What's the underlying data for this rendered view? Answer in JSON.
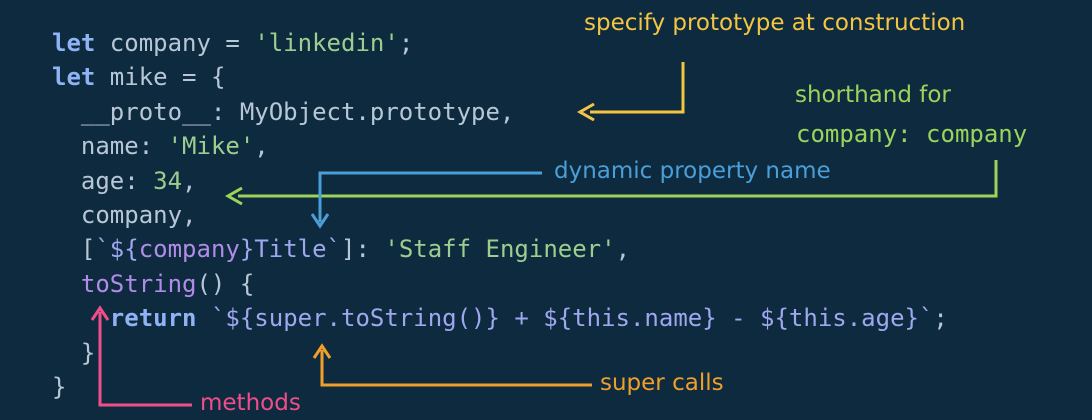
{
  "code": {
    "lines": [
      {
        "indent": 0,
        "tokens": [
          {
            "t": "let",
            "c": "kw"
          },
          {
            "t": " company = ",
            "c": "plain"
          },
          {
            "t": "'linkedin'",
            "c": "str"
          },
          {
            "t": ";",
            "c": "plain"
          }
        ]
      },
      {
        "indent": 0,
        "tokens": [
          {
            "t": "let",
            "c": "kw"
          },
          {
            "t": " mike = {",
            "c": "plain"
          }
        ]
      },
      {
        "indent": 2,
        "tokens": [
          {
            "t": "__proto__: MyObject.prototype,",
            "c": "plain"
          }
        ]
      },
      {
        "indent": 2,
        "tokens": [
          {
            "t": "name: ",
            "c": "plain"
          },
          {
            "t": "'Mike'",
            "c": "str"
          },
          {
            "t": ",",
            "c": "plain"
          }
        ]
      },
      {
        "indent": 2,
        "tokens": [
          {
            "t": "age: ",
            "c": "plain"
          },
          {
            "t": "34",
            "c": "num"
          },
          {
            "t": ",",
            "c": "plain"
          }
        ]
      },
      {
        "indent": 2,
        "tokens": [
          {
            "t": "company,",
            "c": "plain"
          }
        ]
      },
      {
        "indent": 2,
        "tokens": [
          {
            "t": "[",
            "c": "plain"
          },
          {
            "t": "`${",
            "c": "tmpl"
          },
          {
            "t": "company",
            "c": "fn"
          },
          {
            "t": "}",
            "c": "tmpl"
          },
          {
            "t": "Title`",
            "c": "tmpl"
          },
          {
            "t": "]: ",
            "c": "plain"
          },
          {
            "t": "'Staff Engineer'",
            "c": "str"
          },
          {
            "t": ",",
            "c": "plain"
          }
        ]
      },
      {
        "indent": 2,
        "tokens": [
          {
            "t": "toString",
            "c": "fn"
          },
          {
            "t": "() {",
            "c": "plain"
          }
        ]
      },
      {
        "indent": 4,
        "tokens": [
          {
            "t": "return",
            "c": "kw"
          },
          {
            "t": " ",
            "c": "plain"
          },
          {
            "t": "`${super.toString()} + ${this.name} - ${this.age}`",
            "c": "tmpl"
          },
          {
            "t": ";",
            "c": "plain"
          }
        ]
      },
      {
        "indent": 2,
        "tokens": [
          {
            "t": "}",
            "c": "plain"
          }
        ]
      },
      {
        "indent": 0,
        "tokens": [
          {
            "t": "}",
            "c": "plain"
          }
        ]
      }
    ]
  },
  "annotations": {
    "proto": "specify prototype at construction",
    "shorthand_1": "shorthand for",
    "shorthand_2": "company: company",
    "dynamic": "dynamic property name",
    "super": "super calls",
    "methods": "methods"
  },
  "colors": {
    "background": "#0e2a3f",
    "kw": "#8fb3f5",
    "plain": "#b8c7d6",
    "str": "#9ccf8f",
    "num": "#9ccf8f",
    "tmpl": "#9fa7ef",
    "fn": "#b08ce8",
    "proto": "#f4c542",
    "shorthand": "#9dd35b",
    "dynamic": "#4a9fd8",
    "super": "#f0a02a",
    "methods": "#f04e8a"
  }
}
